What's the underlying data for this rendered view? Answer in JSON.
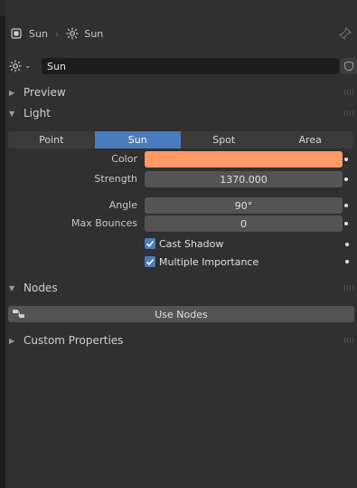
{
  "breadcrumb": {
    "object_name": "Sun",
    "data_name": "Sun"
  },
  "datablock": {
    "name": "Sun"
  },
  "sections": {
    "preview": "Preview",
    "light": "Light",
    "nodes": "Nodes",
    "custom_properties": "Custom Properties"
  },
  "light_types": [
    "Point",
    "Sun",
    "Spot",
    "Area"
  ],
  "light_types_active": "Sun",
  "properties": {
    "color_label": "Color",
    "color_value": "#ff9966",
    "strength_label": "Strength",
    "strength_value": "1370.000",
    "angle_label": "Angle",
    "angle_value": "90°",
    "max_bounces_label": "Max Bounces",
    "max_bounces_value": "0",
    "cast_shadow_label": "Cast Shadow",
    "cast_shadow_checked": true,
    "multiple_importance_label": "Multiple Importance",
    "multiple_importance_checked": true
  },
  "nodes": {
    "use_nodes_label": "Use Nodes"
  },
  "colors": {
    "accent": "#4b7bbf",
    "light_color": "#ff9966"
  },
  "icons": {
    "object": "object-icon",
    "sun": "sun-icon",
    "pin": "pin-icon",
    "shield": "shield-icon",
    "node_tree": "node-tree-icon"
  }
}
